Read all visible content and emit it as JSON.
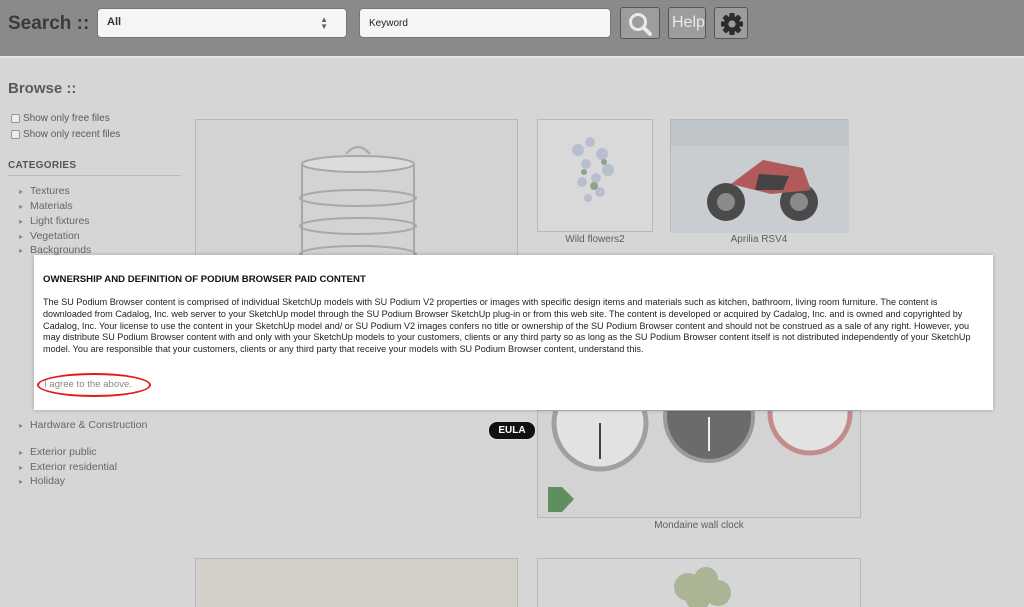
{
  "header": {
    "search_label": "Search ::",
    "category_select_value": "All",
    "keyword_value": "Keyword",
    "help_label": "Help"
  },
  "sidebar": {
    "title": "Browse ::",
    "filters": [
      {
        "label": "Show only free files",
        "checked": false
      },
      {
        "label": "Show only recent files",
        "checked": false
      }
    ],
    "categories_heading": "CATEGORIES",
    "categories": [
      "Textures",
      "Materials",
      "Light fixtures",
      "Vegetation",
      "Backgrounds",
      "Hardware & Construction",
      "Exterior public",
      "Exterior residential",
      "Holiday"
    ]
  },
  "gallery": {
    "items": [
      {
        "caption": "Wild flowers2"
      },
      {
        "caption": "Aprilia RSV4"
      },
      {
        "caption": "Mondaine wall clock"
      }
    ]
  },
  "modal": {
    "heading": "OWNERSHIP AND DEFINITION OF PODIUM BROWSER PAID CONTENT",
    "body": "The SU Podium Browser content is comprised of individual SketchUp models with SU Podium V2 properties or images with specific design items and materials such as kitchen, bathroom, living room furniture. The content is downloaded from Cadalog, Inc. web server to your SketchUp model through the SU Podium Browser SketchUp plug-in or from this web site. The content is developed or acquired by Cadalog, Inc. and is owned and copyrighted by Cadalog, Inc. Your license to use the content in your SketchUp model and/ or SU Podium V2 images confers no title or ownership of the SU Podium Browser content and should not be construed as a sale of any right. However, you may distribute SU Podium Browser content with and only with your SketchUp models to your customers, clients or any third party so as long as the SU Podium Browser content itself is not distributed independently of your SketchUp model. You are responsible that your customers, clients or any third party that receive your models with SU Podium Browser content, understand this.",
    "agree_label": "I agree to the above.",
    "tab_label": "EULA"
  },
  "colors": {
    "highlight_ring": "#e3191d",
    "overlay_bg": "#d6d6d6",
    "topbar_bg": "#8a8a8a"
  }
}
